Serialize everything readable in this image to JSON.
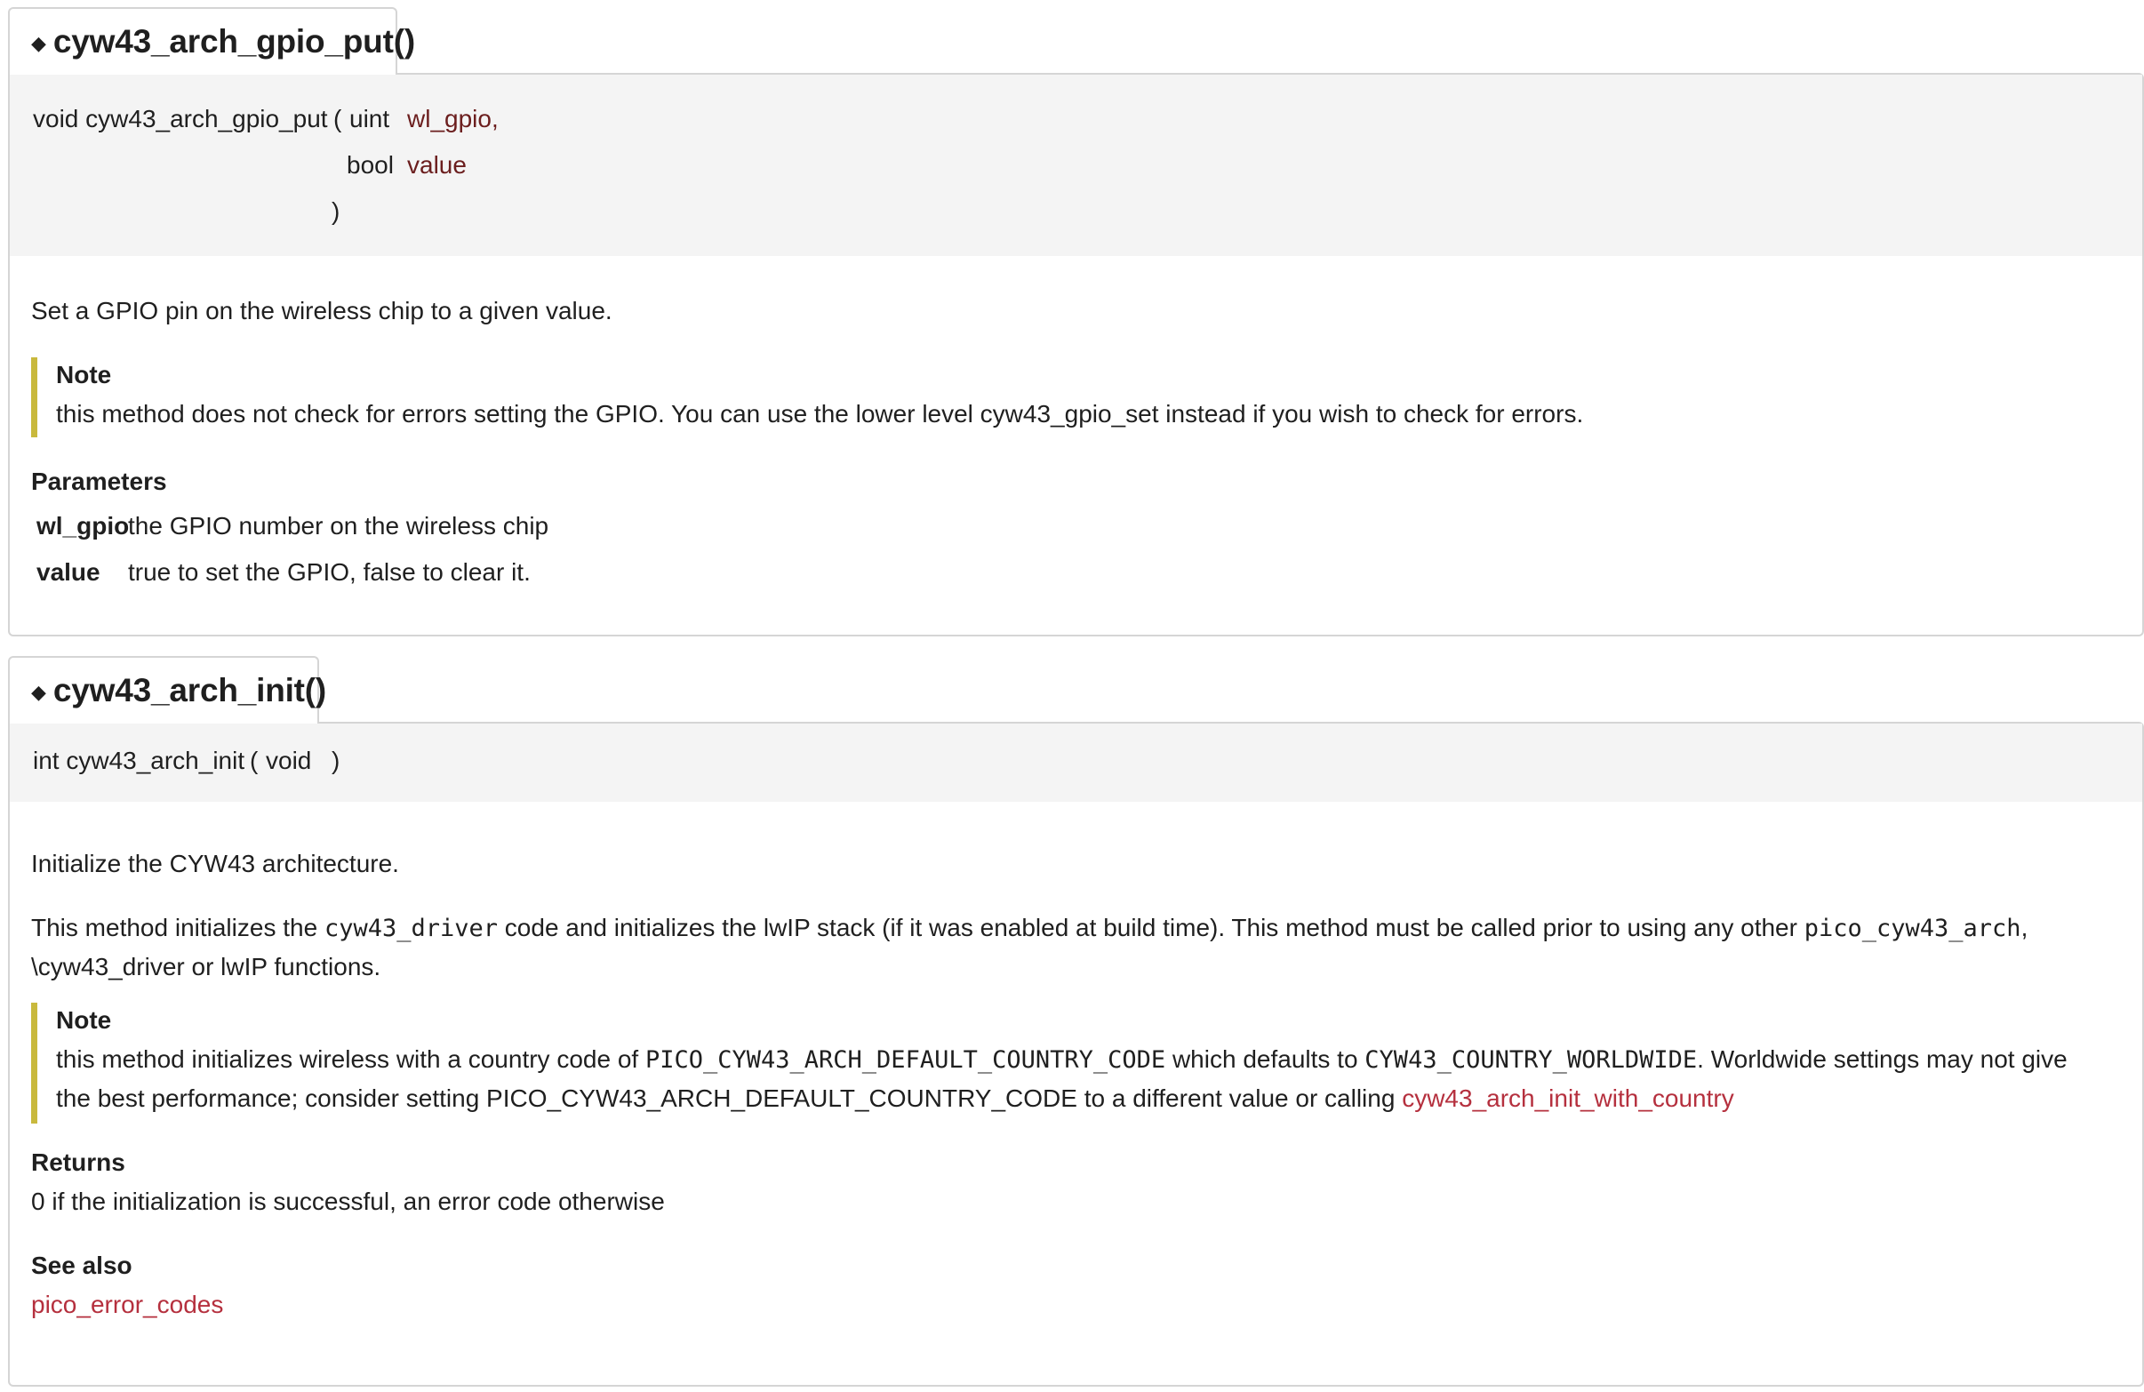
{
  "gpio_put": {
    "title": "cyw43_arch_gpio_put()",
    "proto": {
      "ret_name": "void cyw43_arch_gpio_put",
      "open_paren": "(",
      "p1_type": "uint",
      "p1_name": "wl_gpio,",
      "p2_type": "bool",
      "p2_name": "value",
      "close_paren": ")"
    },
    "brief": "Set a GPIO pin on the wireless chip to a given value.",
    "note_title": "Note",
    "note_text": "this method does not check for errors setting the GPIO. You can use the lower level cyw43_gpio_set instead if you wish to check for errors.",
    "params_title": "Parameters",
    "params": [
      {
        "name": "wl_gpio",
        "desc": "the GPIO number on the wireless chip"
      },
      {
        "name": "value",
        "desc": "true to set the GPIO, false to clear it."
      }
    ]
  },
  "init": {
    "title": "cyw43_arch_init()",
    "proto": {
      "ret_name": "int cyw43_arch_init",
      "open_paren": "(",
      "p1_type": "void",
      "close_paren": ")"
    },
    "brief": "Initialize the CYW43 architecture.",
    "desc": {
      "part1": "This method initializes the ",
      "code1": "cyw43_driver",
      "part2": " code and initializes the lwIP stack (if it was enabled at build time). This method must be called prior to using any other ",
      "code2": "pico_cyw43_arch",
      "part3": ",",
      "line2": "\\cyw43_driver or lwIP functions."
    },
    "note_title": "Note",
    "note": {
      "part1": "this method initializes wireless with a country code of ",
      "code1": "PICO_CYW43_ARCH_DEFAULT_COUNTRY_CODE",
      "part2": " which defaults to ",
      "code2": "CYW43_COUNTRY_WORLDWIDE",
      "part3": ". Worldwide settings may not give",
      "line2a": "the best performance; consider setting PICO_CYW43_ARCH_DEFAULT_COUNTRY_CODE to a different value or calling ",
      "link": "cyw43_arch_init_with_country"
    },
    "returns_title": "Returns",
    "returns_text": "0 if the initialization is successful, an error code otherwise",
    "seealso_title": "See also",
    "seealso_link": "pico_error_codes"
  }
}
